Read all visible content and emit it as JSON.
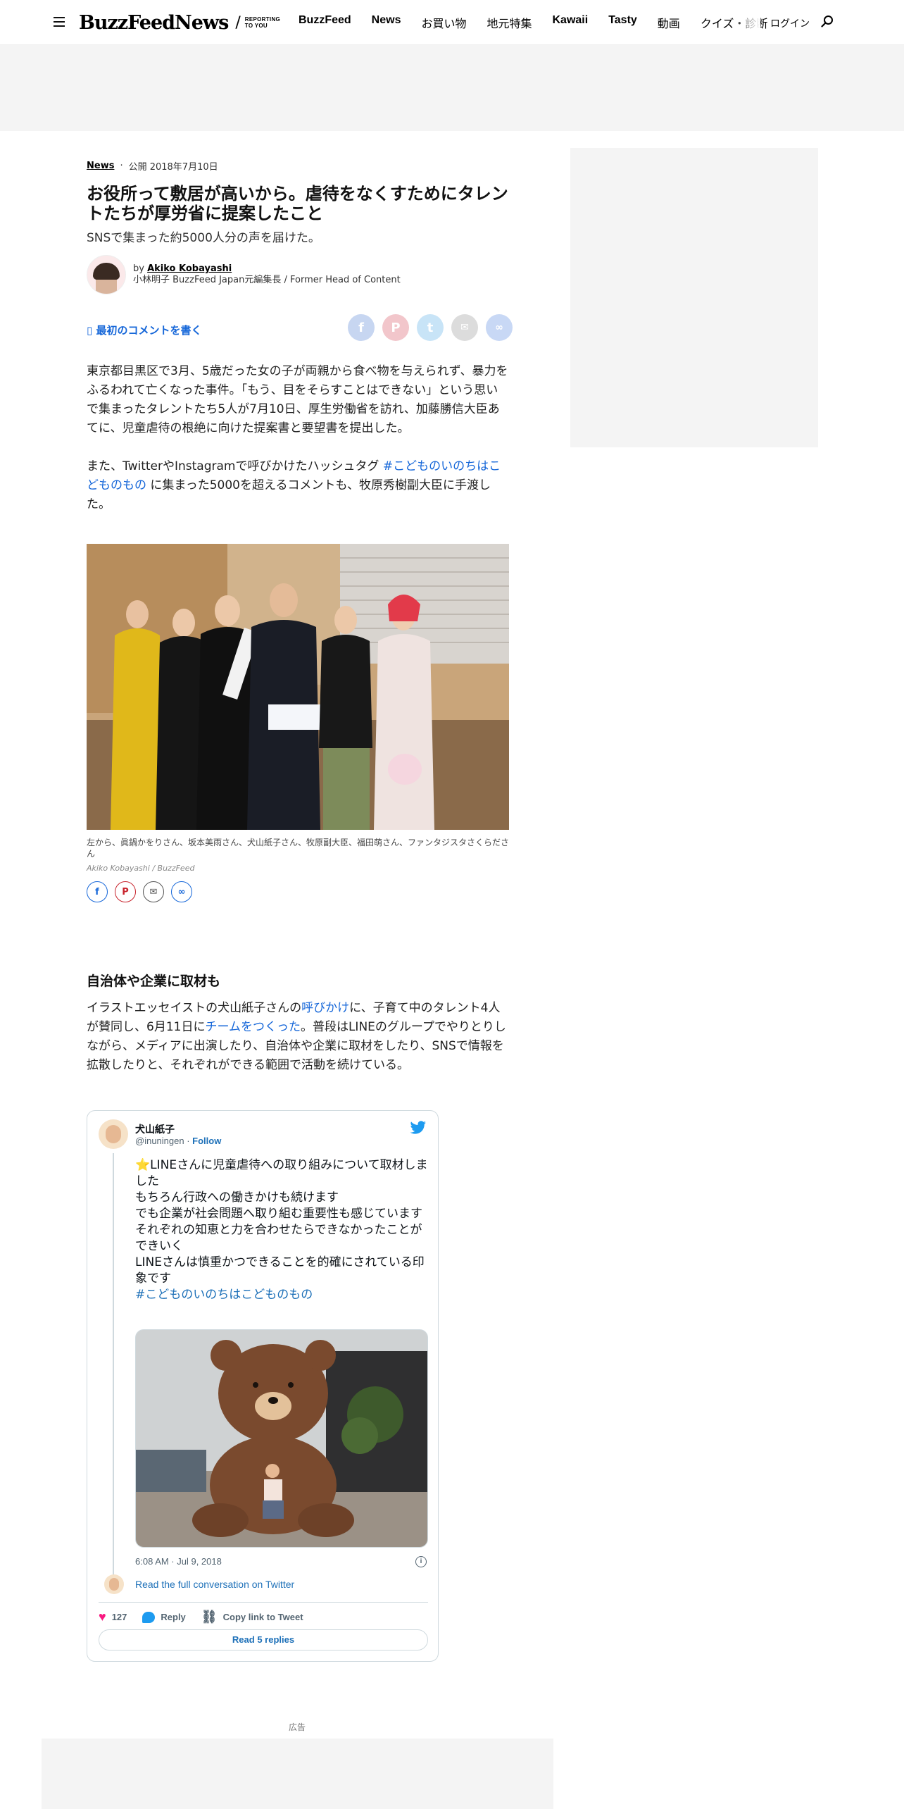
{
  "header": {
    "logo_main": "BuzzFeed",
    "logo_news": "News",
    "logo_tagline_1": "REPORTING",
    "logo_tagline_2": "TO YOU",
    "nav": [
      {
        "label": "BuzzFeed",
        "bold": true
      },
      {
        "label": "News",
        "bold": true
      },
      {
        "label": "お買い物",
        "bold": false
      },
      {
        "label": "地元特集",
        "bold": false
      },
      {
        "label": "Kawaii",
        "bold": true
      },
      {
        "label": "Tasty",
        "bold": true
      },
      {
        "label": "動画",
        "bold": false
      },
      {
        "label": "クイズ・診断",
        "bold": false
      }
    ],
    "login": "ログイン"
  },
  "article": {
    "category": "News",
    "published": "公開 2018年7月10日",
    "title": "お役所って敷居が高いから。虐待をなくすためにタレントたちが厚労省に提案したこと",
    "subtitle": "SNSで集まった約5000人分の声を届けた。",
    "byline_prefix": "by",
    "author": "Akiko Kobayashi",
    "author_role": "小林明子 BuzzFeed Japan元編集長 / Former Head of Content",
    "comment_link": "最初のコメントを書く",
    "p1": "東京都目黒区で3月、5歳だった女の子が両親から食べ物を与えられず、暴力をふるわれて亡くなった事件。「もう、目をそらすことはできない」という思いで集まったタレントたち5人が7月10日、厚生労働省を訪れ、加藤勝信大臣あてに、児童虐待の根絶に向けた提案書と要望書を提出した。",
    "p2_before": "また、TwitterやInstagramで呼びかけたハッシュタグ ",
    "p2_link": "#こどものいのちはこどものもの",
    "p2_after": " に集まった5000を超えるコメントも、牧原秀樹副大臣に手渡した。",
    "photo_caption": "左から、眞鍋かをりさん、坂本美雨さん、犬山紙子さん、牧原副大臣、福田萌さん、ファンタジスタさくらださん",
    "photo_credit": "Akiko Kobayashi / BuzzFeed",
    "section_title": "自治体や企業に取材も",
    "p3_a": "イラストエッセイストの犬山紙子さんの",
    "p3_link1": "呼びかけ",
    "p3_b": "に、子育て中のタレント4人が賛同し、6月11日に",
    "p3_link2": "チームをつくった",
    "p3_c": "。普段はLINEのグループでやりとりしながら、メディアに出演したり、自治体や企業に取材をしたり、SNSで情報を拡散したりと、それぞれができる範囲で活動を続けている。"
  },
  "tweet": {
    "name": "犬山紙子",
    "handle": "@inuningen",
    "follow": "Follow",
    "lines": [
      "⭐LINEさんに児童虐待への取り組みについて取材しました",
      "もちろん行政への働きかけも続けます",
      "でも企業が社会問題へ取り組む重要性も感じています",
      "それぞれの知恵と力を合わせたらできなかったことができいく",
      "LINEさんは慎重かつできることを的確にされている印象です"
    ],
    "hashtag": "#こどものいのちはこどものもの",
    "time": "6:08 AM · Jul 9, 2018",
    "read_conversation": "Read the full conversation on Twitter",
    "likes": "127",
    "reply": "Reply",
    "copy_link": "Copy link to Tweet",
    "read_replies": "Read 5 replies"
  },
  "ad_label": "広告",
  "colors": {
    "link": "#1667d9",
    "ad_background": "#f4f4f4",
    "twitter_blue": "#1d9bf0",
    "heart": "#f91880"
  }
}
